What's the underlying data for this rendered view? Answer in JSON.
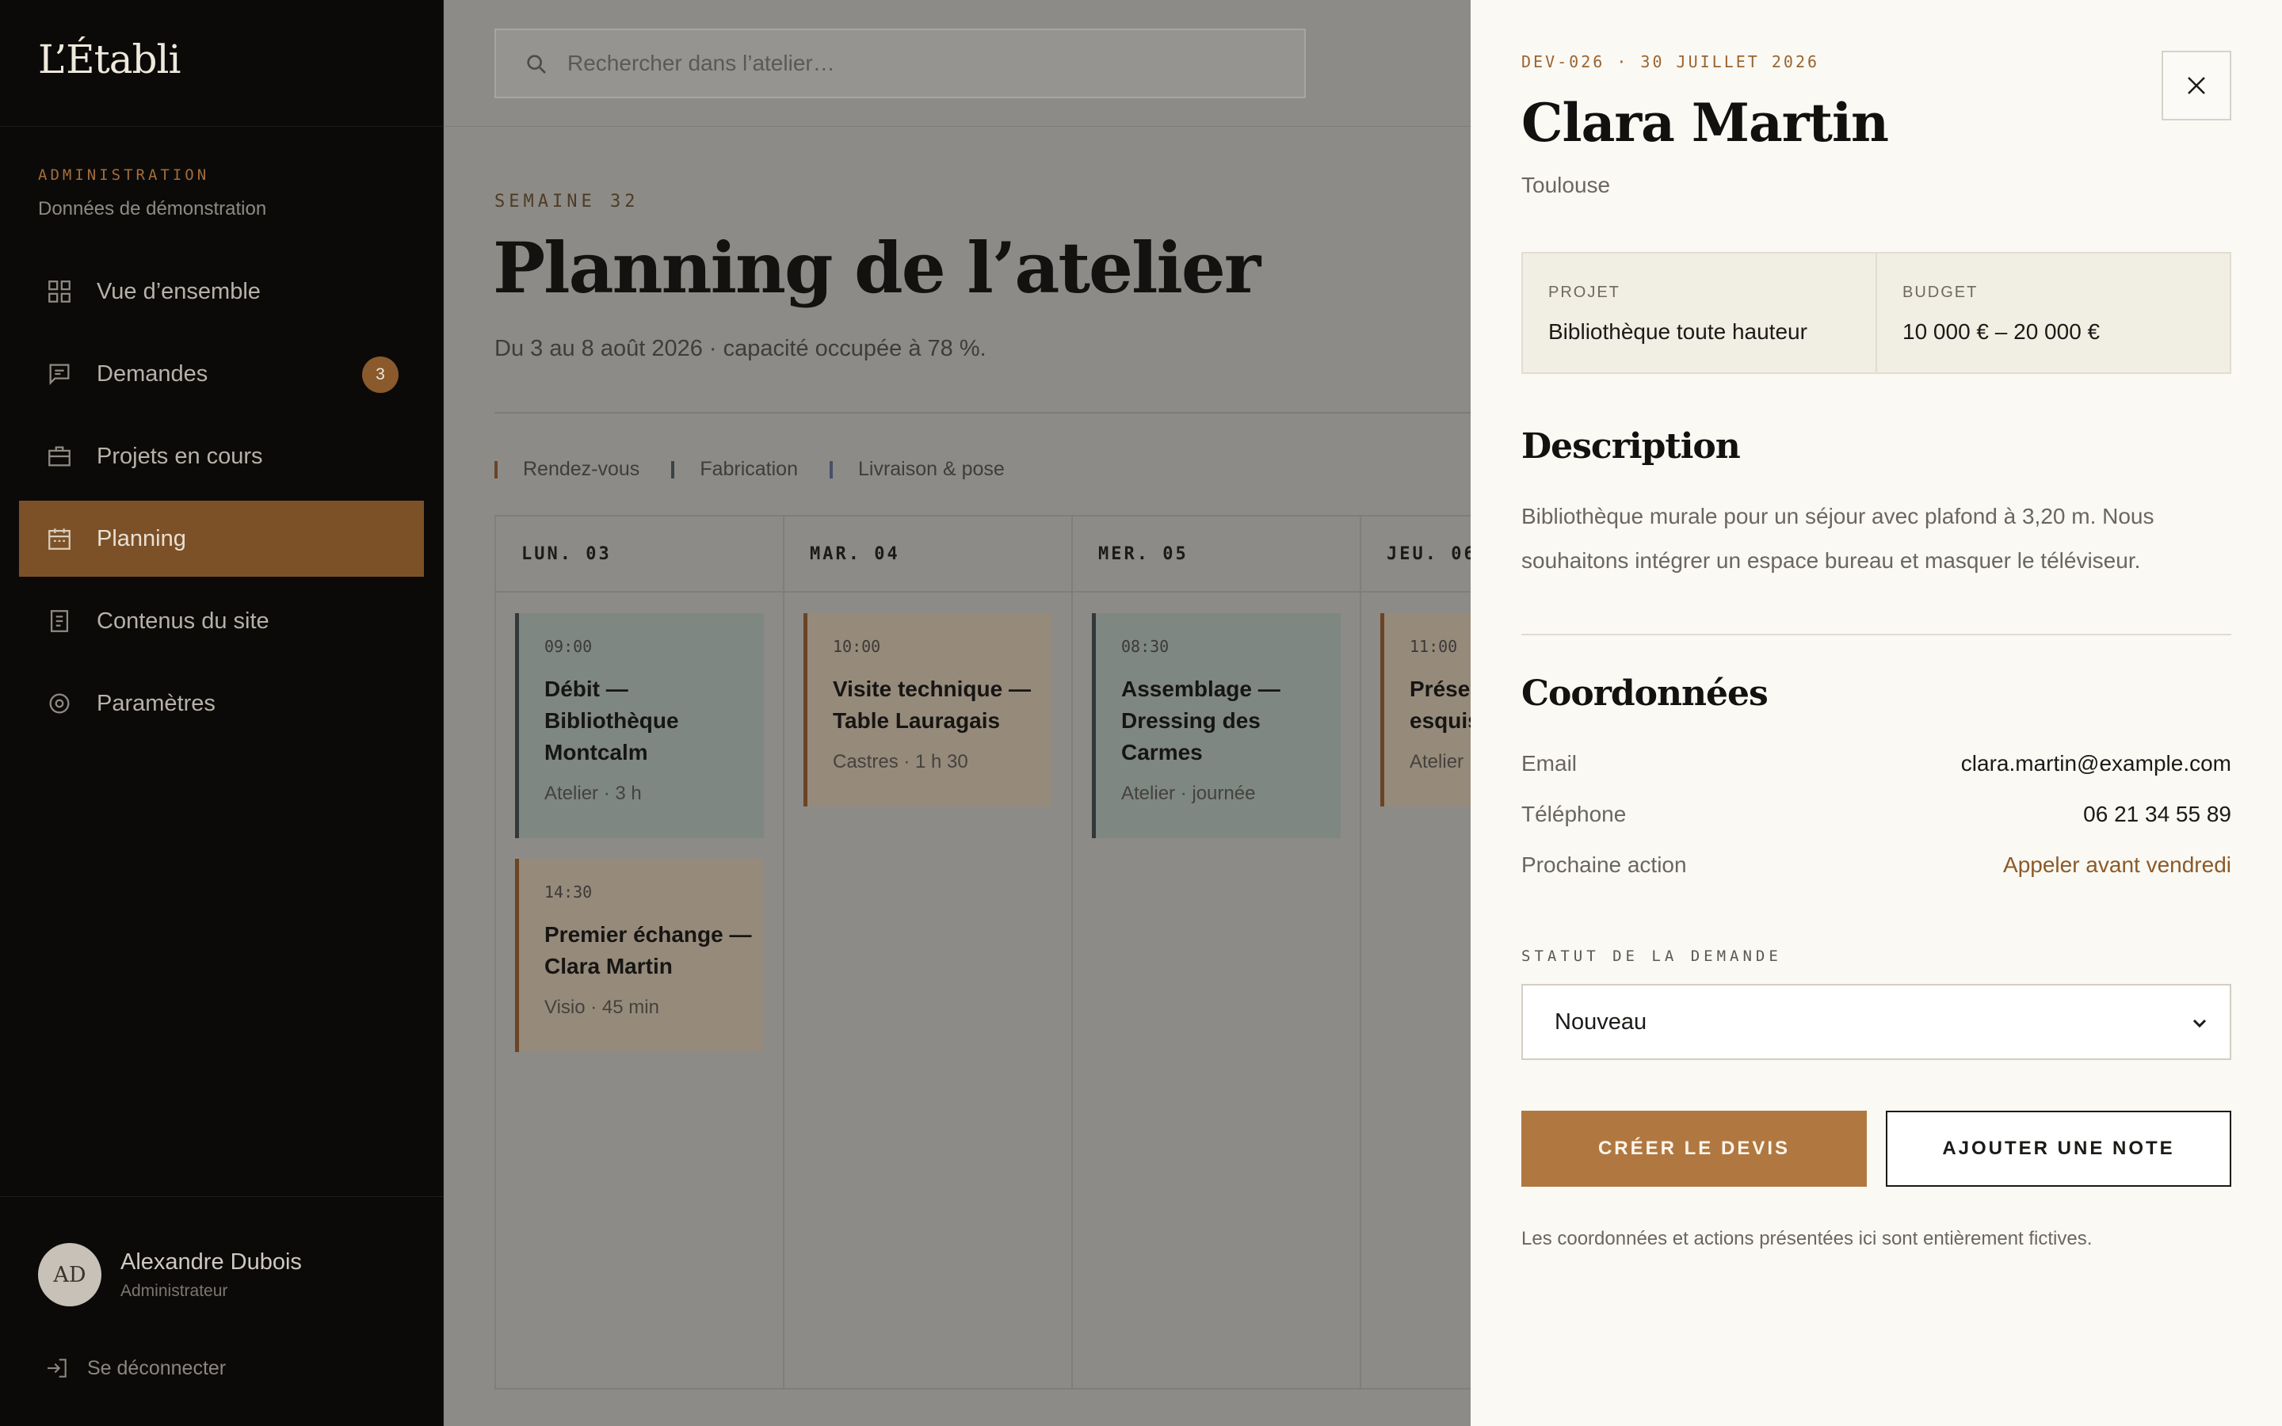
{
  "sidebar": {
    "brand": "L’Établi",
    "admin_kicker": "ADMINISTRATION",
    "admin_sub": "Données de démonstration",
    "items": [
      {
        "label": "Vue d’ensemble"
      },
      {
        "label": "Demandes",
        "badge": "3"
      },
      {
        "label": "Projets en cours"
      },
      {
        "label": "Planning",
        "active": true
      },
      {
        "label": "Contenus du site"
      },
      {
        "label": "Paramètres"
      }
    ],
    "user": {
      "initials": "AD",
      "name": "Alexandre Dubois",
      "role": "Administrateur"
    },
    "logout_label": "Se déconnecter"
  },
  "main": {
    "search_placeholder": "Rechercher dans l’atelier…",
    "week_kicker": "SEMAINE 32",
    "title": "Planning de l’atelier",
    "subtitle": "Du 3 au 8 août 2026 · capacité occupée à 78 %.",
    "legend": [
      {
        "label": "Rendez-vous",
        "color": "#6b4424"
      },
      {
        "label": "Fabrication",
        "color": "#3d4245"
      },
      {
        "label": "Livraison & pose",
        "color": "#4a4f6a"
      }
    ],
    "days": [
      {
        "label": "LUN. 03",
        "events": [
          {
            "time": "09:00",
            "title": "Débit — Bibliothèque Montcalm",
            "meta": "Atelier · 3 h",
            "kind": "fab"
          },
          {
            "time": "14:30",
            "title": "Premier échange — Clara Martin",
            "meta": "Visio · 45 min",
            "kind": "rdv"
          }
        ]
      },
      {
        "label": "MAR. 04",
        "events": [
          {
            "time": "10:00",
            "title": "Visite technique — Table Lauragais",
            "meta": "Castres · 1 h 30",
            "kind": "rdv"
          }
        ]
      },
      {
        "label": "MER. 05",
        "events": [
          {
            "time": "08:30",
            "title": "Assemblage — Dressing des Carmes",
            "meta": "Atelier · journée",
            "kind": "fab"
          }
        ]
      },
      {
        "label": "JEU. 06",
        "events": [
          {
            "time": "11:00",
            "title": "Présentation esquisses",
            "meta": "Atelier",
            "kind": "rdv"
          }
        ]
      }
    ]
  },
  "drawer": {
    "ref": "DEV-026 · 30 JUILLET 2026",
    "name": "Clara Martin",
    "city": "Toulouse",
    "project_label": "PROJET",
    "project_value": "Bibliothèque toute hauteur",
    "budget_label": "BUDGET",
    "budget_value": "10 000 € – 20 000 €",
    "description_heading": "Description",
    "description": "Bibliothèque murale pour un séjour avec plafond à 3,20 m. Nous souhaitons intégrer un espace bureau et masquer le téléviseur.",
    "coords_heading": "Coordonnées",
    "email_label": "Email",
    "email_value": "clara.martin@example.com",
    "phone_label": "Téléphone",
    "phone_value": "06 21 34 55 89",
    "next_label": "Prochaine action",
    "next_value": "Appeler avant vendredi",
    "status_label": "STATUT DE LA DEMANDE",
    "status_value": "Nouveau",
    "primary_button": "CRÉER LE DEVIS",
    "secondary_button": "AJOUTER UNE NOTE",
    "disclaimer": "Les coordonnées et actions présentées ici sont entièrement fictives."
  }
}
